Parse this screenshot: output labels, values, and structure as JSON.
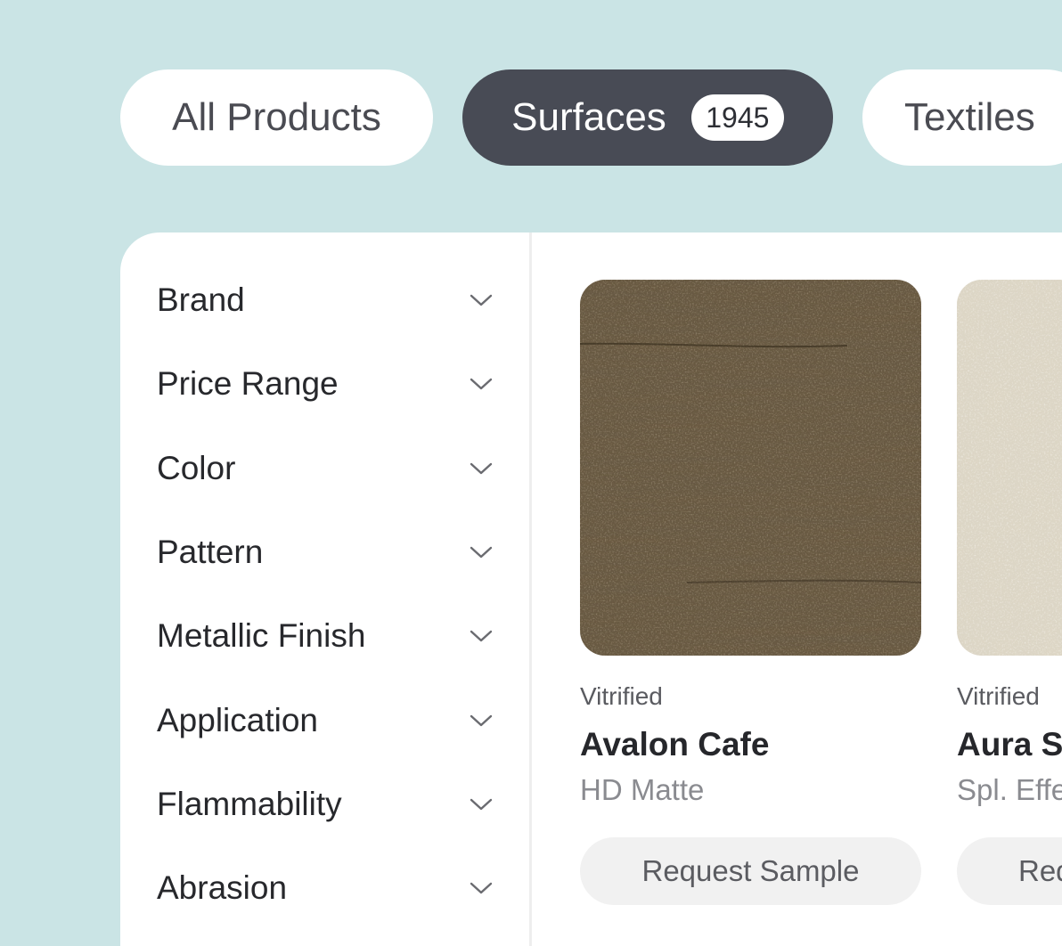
{
  "tabs": [
    {
      "label": "All Products",
      "active": false
    },
    {
      "label": "Surfaces",
      "active": true,
      "count": "1945"
    },
    {
      "label": "Textiles",
      "active": false
    }
  ],
  "filters": [
    {
      "label": "Brand"
    },
    {
      "label": "Price Range"
    },
    {
      "label": "Color"
    },
    {
      "label": "Pattern"
    },
    {
      "label": "Metallic Finish"
    },
    {
      "label": "Application"
    },
    {
      "label": "Flammability"
    },
    {
      "label": "Abrasion"
    }
  ],
  "products": [
    {
      "category": "Vitrified",
      "name": "Avalon Cafe",
      "finish": "HD Matte",
      "action": "Request Sample",
      "swatch_color": "#6a5940"
    },
    {
      "category": "Vitrified",
      "name": "Aura Sa",
      "finish": "Spl. Effe",
      "action": "Req",
      "swatch_color": "#ddd6c5"
    }
  ],
  "colors": {
    "background": "#cae4e5",
    "active_tab": "#484b55",
    "panel": "#ffffff"
  },
  "icons": {
    "filter_toggle": "chevron-down-icon"
  }
}
